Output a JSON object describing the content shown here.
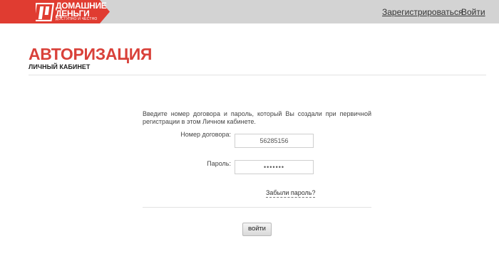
{
  "brand": {
    "name_line1": "ДОМАШНИЕ",
    "name_line2": "ДЕНЬГИ",
    "tagline": "ДОСТУПНО И ЧЕСТНО",
    "color": "#e03c31"
  },
  "header": {
    "register_label": "Зарегистрироваться",
    "login_label": "Войти"
  },
  "page": {
    "title": "АВТОРИЗАЦИЯ",
    "subtitle": "ЛИЧНЫЙ КАБИНЕТ",
    "title_color": "#d9413a"
  },
  "form": {
    "intro": "Введите номер договора и пароль, который Вы создали при первичной регистрации в этом Личном кабинете.",
    "contract_label": "Номер договора:",
    "contract_value": "56285156",
    "password_label": "Пароль:",
    "password_value": "•••••••",
    "forgot_label": "Забыли пароль?",
    "submit_label": "ВОЙТИ"
  }
}
